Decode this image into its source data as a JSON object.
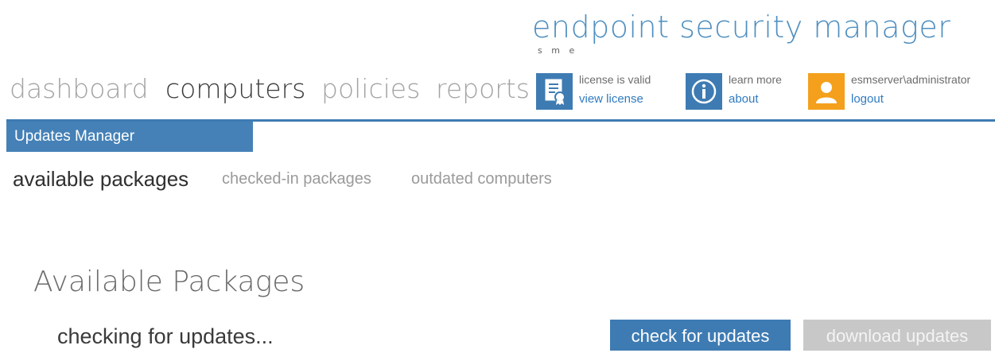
{
  "brand": {
    "title": "endpoint security manager",
    "subtitle": "s m e"
  },
  "nav": {
    "items": [
      {
        "label": "dashboard",
        "active": false
      },
      {
        "label": "computers",
        "active": true
      },
      {
        "label": "policies",
        "active": false
      },
      {
        "label": "reports",
        "active": false
      }
    ]
  },
  "tiles": {
    "license": {
      "status": "license is valid",
      "link": "view license",
      "icon": "certificate-icon"
    },
    "about": {
      "text": "learn more",
      "link": "about",
      "icon": "info-icon"
    },
    "user": {
      "name": "esmserver\\administrator",
      "link": "logout",
      "icon": "user-avatar-icon"
    }
  },
  "section": {
    "header": "Updates Manager"
  },
  "sub_tabs": [
    {
      "label": "available packages",
      "active": true
    },
    {
      "label": "checked-in packages",
      "active": false
    },
    {
      "label": "outdated computers",
      "active": false
    }
  ],
  "content": {
    "title": "Available Packages",
    "status": "checking for updates...",
    "check_button": "check for updates",
    "download_button": "download updates"
  },
  "colors": {
    "accent": "#3e7bb3",
    "brand_text": "#4f8fc0",
    "user_tile": "#f4a01c",
    "disabled_button": "#c8c8c8"
  }
}
